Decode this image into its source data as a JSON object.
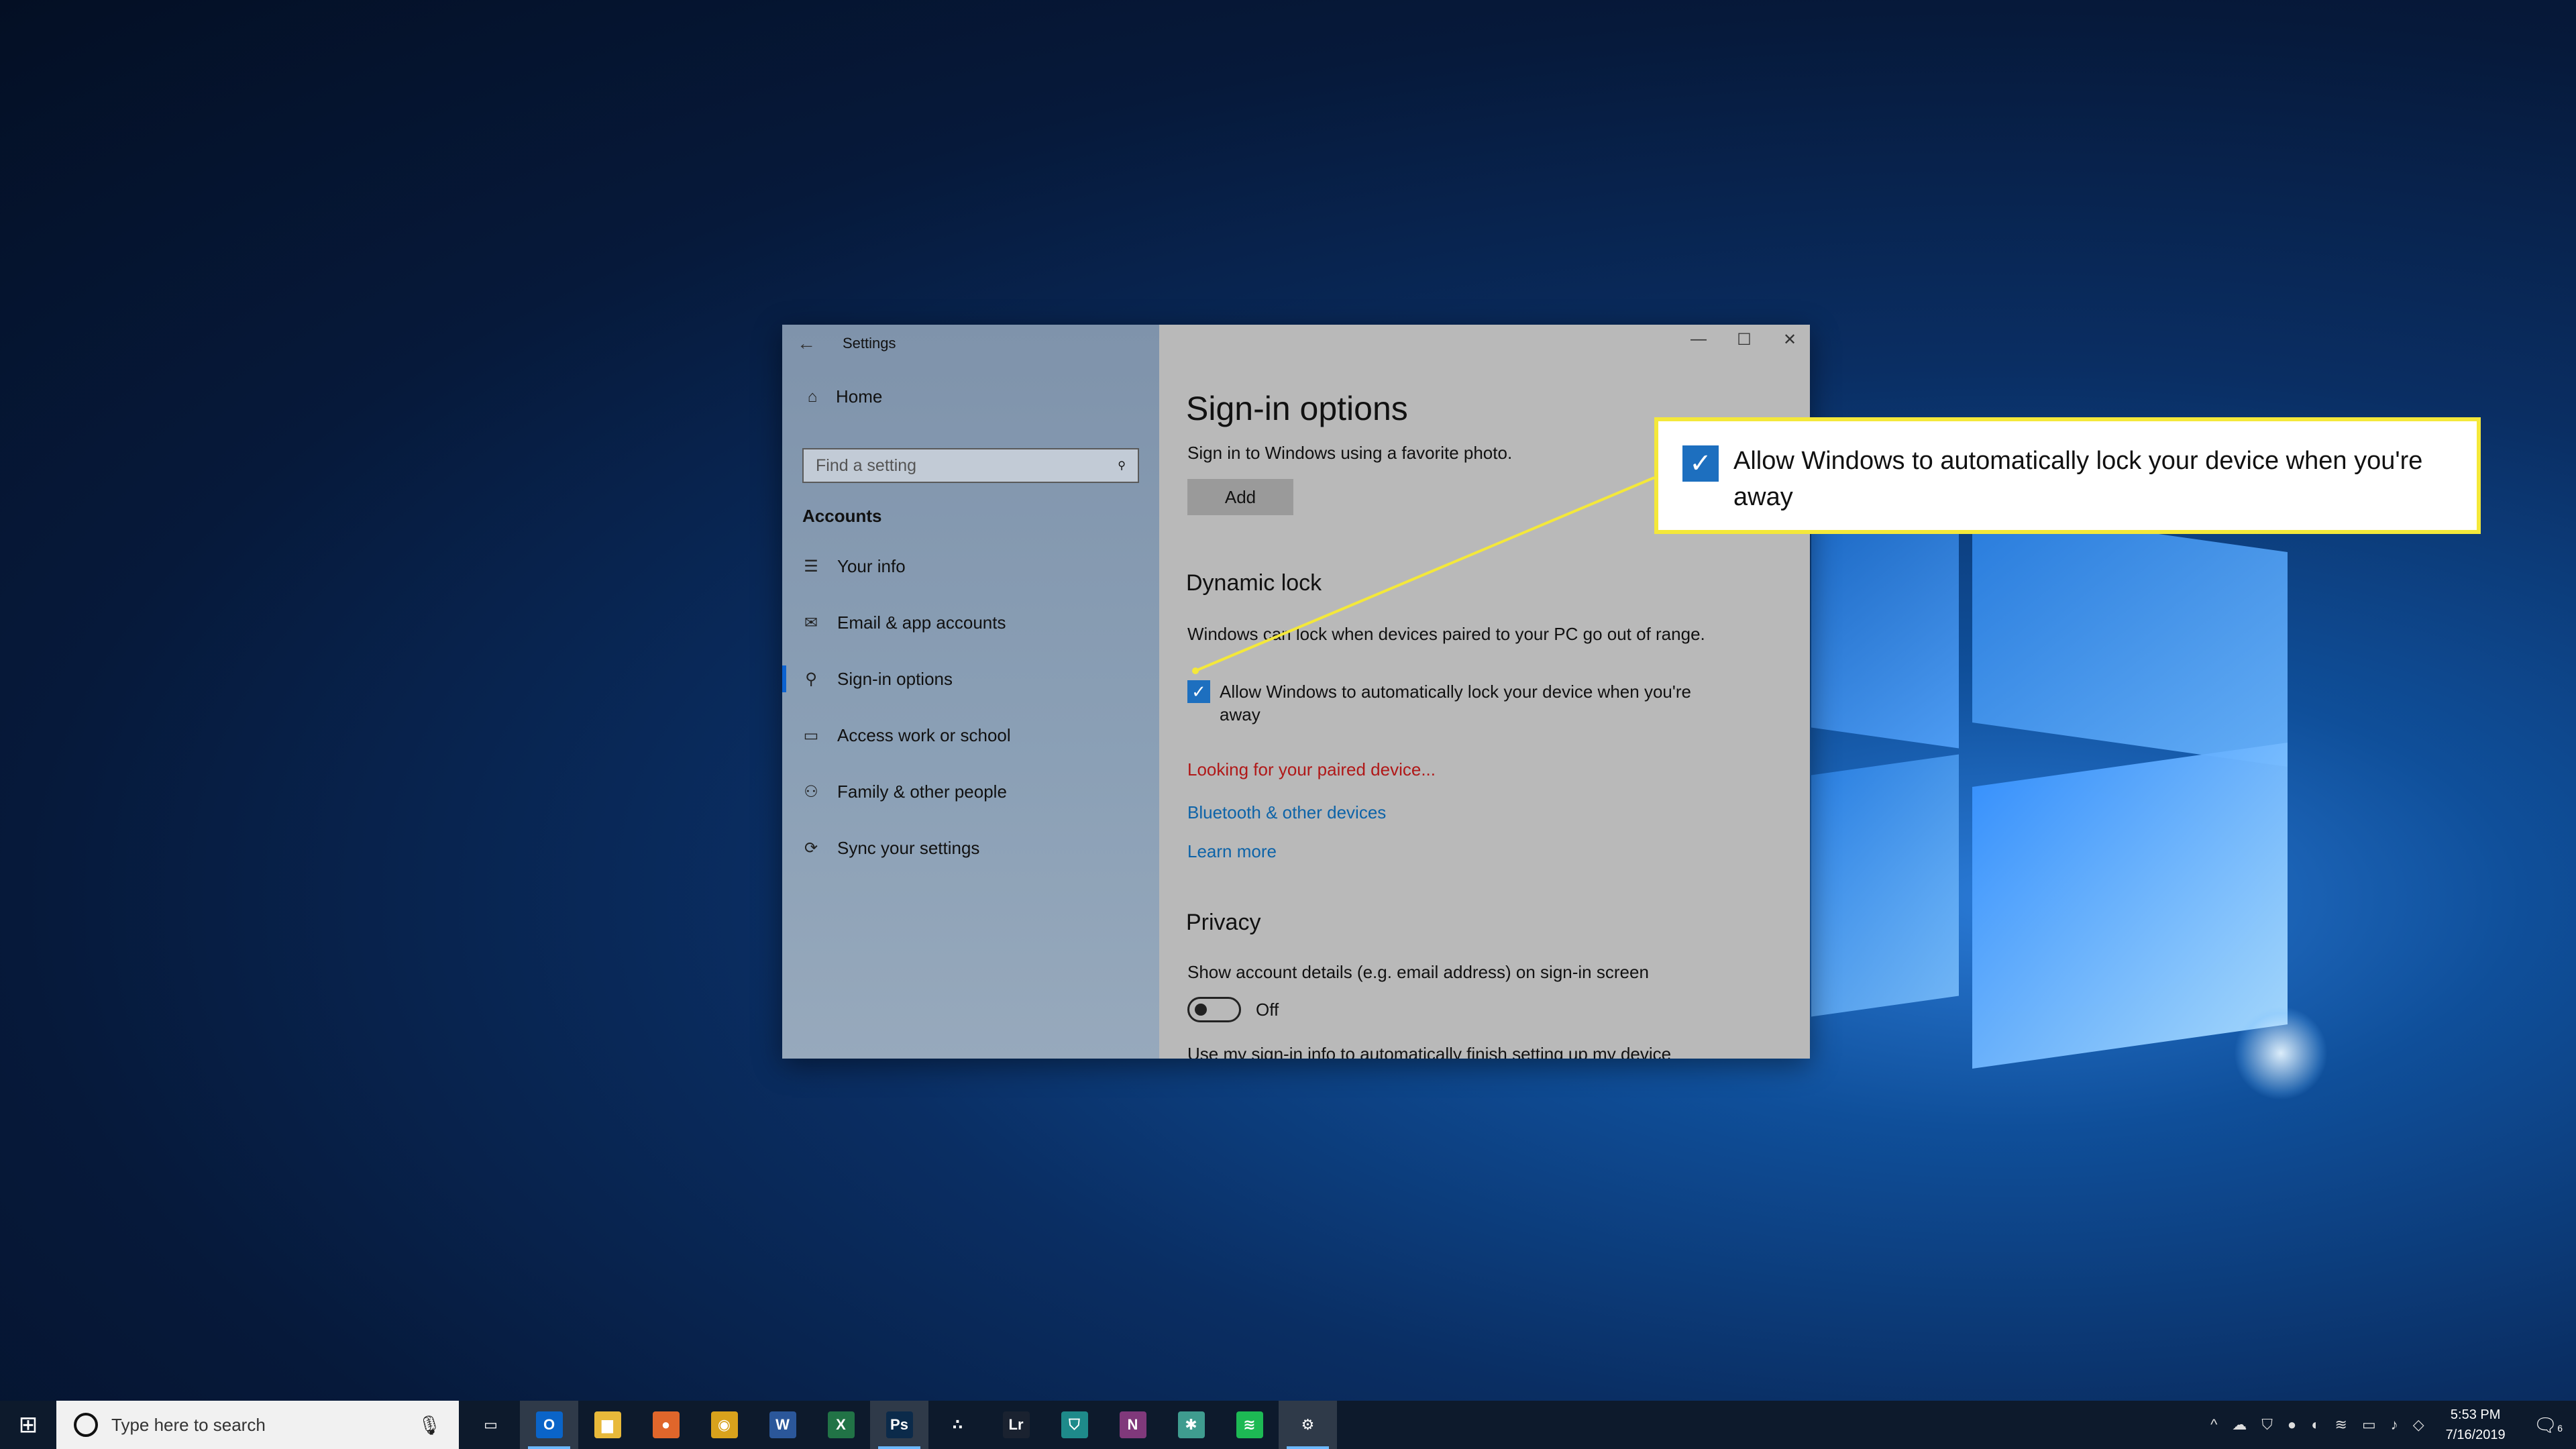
{
  "window": {
    "app_title": "Settings",
    "controls": {
      "minimize": "—",
      "maximize": "☐",
      "close": "✕"
    }
  },
  "sidebar": {
    "home_label": "Home",
    "search_placeholder": "Find a setting",
    "section_title": "Accounts",
    "items": [
      {
        "label": "Your info",
        "icon": "person-card-icon",
        "glyph": "☰"
      },
      {
        "label": "Email & app accounts",
        "icon": "email-icon",
        "glyph": "✉"
      },
      {
        "label": "Sign-in options",
        "icon": "key-icon",
        "glyph": "⚲"
      },
      {
        "label": "Access work or school",
        "icon": "briefcase-icon",
        "glyph": "▭"
      },
      {
        "label": "Family & other people",
        "icon": "person-icon",
        "glyph": "⚇"
      },
      {
        "label": "Sync your settings",
        "icon": "sync-icon",
        "glyph": "⟳"
      }
    ]
  },
  "content": {
    "title": "Sign-in options",
    "photo_text": "Sign in to Windows using a favorite photo.",
    "add_label": "Add",
    "dynamic_lock": {
      "title": "Dynamic lock",
      "description": "Windows can lock when devices paired to your PC go out of range.",
      "checkbox_label": "Allow Windows to automatically lock your device when you're away",
      "checked": true,
      "status": "Looking for your paired device...",
      "bluetooth_link": "Bluetooth & other devices",
      "learn_link": "Learn more"
    },
    "privacy": {
      "title": "Privacy",
      "description": "Show account details (e.g. email address) on sign-in screen",
      "toggle_state": "Off",
      "next_item_partial": "Use my sign-in info to automatically finish setting up my device"
    }
  },
  "callout": {
    "text": "Allow Windows to automatically lock your device when you're away",
    "border_color": "#f4e83a"
  },
  "taskbar": {
    "search_placeholder": "Type here to search",
    "apps": [
      {
        "name": "task-view-icon",
        "glyph": "▭",
        "color": "transparent"
      },
      {
        "name": "outlook-icon",
        "glyph": "O",
        "color": "#0a64c8",
        "active": true
      },
      {
        "name": "file-explorer-icon",
        "glyph": "▆",
        "color": "#e8b93a"
      },
      {
        "name": "firefox-icon",
        "glyph": "●",
        "color": "#e0662b"
      },
      {
        "name": "chrome-icon",
        "glyph": "◉",
        "color": "#d8a21c"
      },
      {
        "name": "word-icon",
        "glyph": "W",
        "color": "#2b579a"
      },
      {
        "name": "excel-icon",
        "glyph": "X",
        "color": "#217346"
      },
      {
        "name": "photoshop-icon",
        "glyph": "Ps",
        "color": "#0b2a4a",
        "active": true
      },
      {
        "name": "sonos-icon",
        "glyph": "∴",
        "color": "transparent"
      },
      {
        "name": "lightroom-icon",
        "glyph": "Lr",
        "color": "#1a2230"
      },
      {
        "name": "security-icon",
        "glyph": "⛉",
        "color": "#1e8a8a"
      },
      {
        "name": "onenote-icon",
        "glyph": "N",
        "color": "#80397b"
      },
      {
        "name": "slack-icon",
        "glyph": "✱",
        "color": "#3f9c8f"
      },
      {
        "name": "spotify-icon",
        "glyph": "≋",
        "color": "#1db954"
      },
      {
        "name": "settings-gear-icon",
        "glyph": "⚙",
        "color": "transparent",
        "active": true
      }
    ],
    "time": "5:53 PM",
    "date": "7/16/2019",
    "notification_count": "6"
  },
  "colors": {
    "accent": "#1d6fbf",
    "link": "#0d63a8",
    "status_red": "#b01818"
  }
}
